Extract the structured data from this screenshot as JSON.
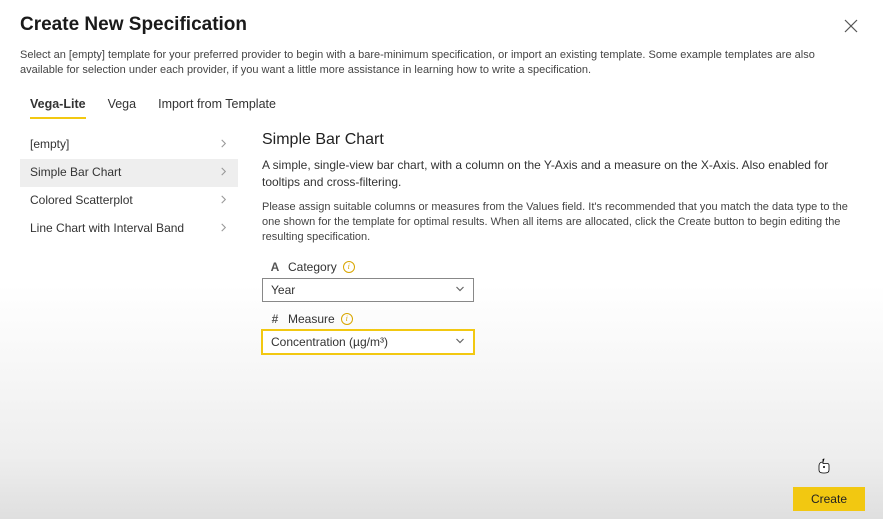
{
  "dialog": {
    "title": "Create New Specification",
    "intro": "Select an [empty] template for your preferred provider to begin with a bare-minimum specification, or import an existing template. Some example templates are also available for selection under each provider, if you want a little more assistance in learning how to write a specification."
  },
  "tabs": {
    "vegaLite": "Vega-Lite",
    "vega": "Vega",
    "import": "Import from Template",
    "active": "Vega-Lite"
  },
  "sidebar": {
    "items": [
      {
        "label": "[empty]"
      },
      {
        "label": "Simple Bar Chart"
      },
      {
        "label": "Colored Scatterplot"
      },
      {
        "label": "Line Chart with Interval Band"
      }
    ],
    "selected": "Simple Bar Chart"
  },
  "main": {
    "title": "Simple Bar Chart",
    "description": "A simple, single-view bar chart, with a column on the Y-Axis and a measure on the X-Axis. Also enabled for tooltips and cross-filtering.",
    "instructions": "Please assign suitable columns or measures from the Values field. It's recommended that you match the data type to the one shown for the template for optimal results. When all items are allocated, click the Create button to begin editing the resulting specification."
  },
  "fields": {
    "category": {
      "typeGlyph": "A",
      "label": "Category",
      "value": "Year"
    },
    "measure": {
      "typeGlyph": "#",
      "label": "Measure",
      "value": "Concentration (µg/m³)"
    }
  },
  "buttons": {
    "create": "Create"
  },
  "colors": {
    "accent": "#f2c811"
  }
}
